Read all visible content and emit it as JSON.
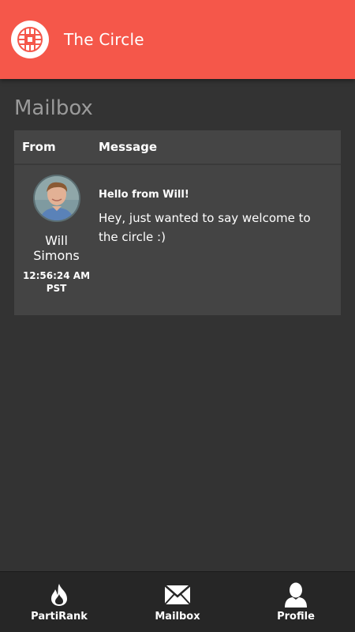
{
  "app": {
    "title": "The Circle",
    "accent": "#f5574a",
    "logo_icon": "circle-knot-logo"
  },
  "page": {
    "title": "Mailbox"
  },
  "table": {
    "headers": {
      "from": "From",
      "message": "Message"
    },
    "rows": [
      {
        "sender": "Will Simons",
        "time": "12:56:24 AM PST",
        "subject": "Hello from Will!",
        "body": "Hey, just wanted to say welcome to the circle :)"
      }
    ]
  },
  "nav": {
    "items": [
      {
        "label": "PartiRank",
        "icon": "flame-icon"
      },
      {
        "label": "Mailbox",
        "icon": "envelope-icon"
      },
      {
        "label": "Profile",
        "icon": "user-icon"
      }
    ]
  }
}
